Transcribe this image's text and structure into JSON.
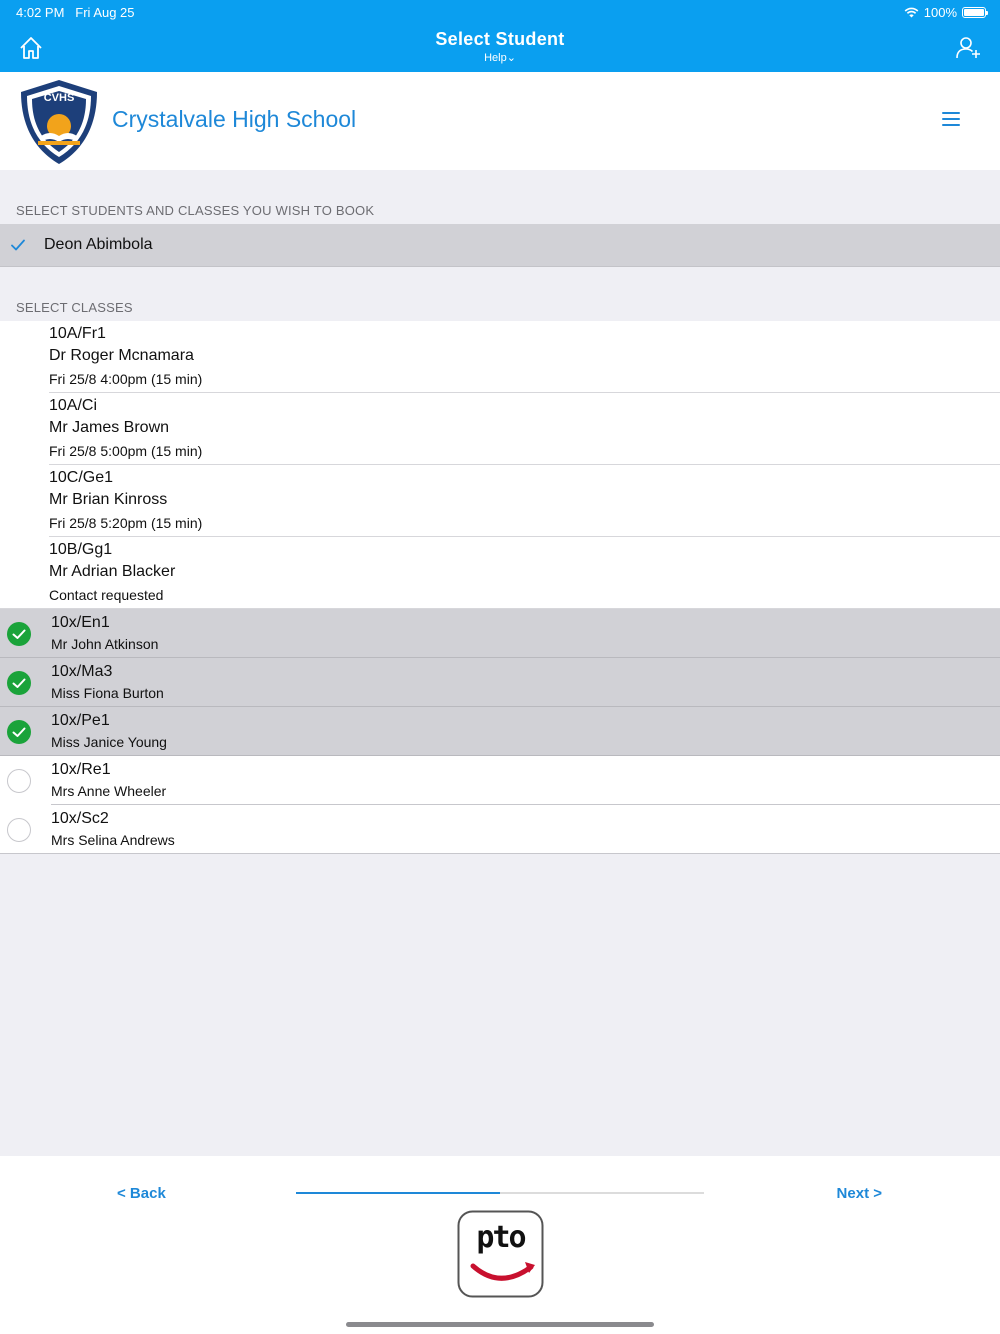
{
  "status_bar": {
    "time": "4:02 PM",
    "date": "Fri Aug 25",
    "battery": "100%"
  },
  "nav": {
    "title": "Select Student",
    "help": "Help⌄"
  },
  "school": {
    "logo_text": "CVHS",
    "name": "Crystalvale High School"
  },
  "students_section": {
    "label": "SELECT STUDENTS AND CLASSES YOU WISH TO BOOK",
    "student": {
      "name": "Deon Abimbola",
      "checked": true
    }
  },
  "classes_section": {
    "label": "SELECT CLASSES",
    "booked": [
      {
        "code": "10A/Fr1",
        "teacher": "Dr Roger Mcnamara",
        "detail": "Fri 25/8 4:00pm (15 min)"
      },
      {
        "code": "10A/Ci",
        "teacher": "Mr James Brown",
        "detail": "Fri 25/8 5:00pm (15 min)"
      },
      {
        "code": "10C/Ge1",
        "teacher": "Mr Brian Kinross",
        "detail": "Fri 25/8 5:20pm (15 min)"
      },
      {
        "code": "10B/Gg1",
        "teacher": "Mr Adrian Blacker",
        "detail": "Contact requested"
      }
    ],
    "selectable": [
      {
        "code": "10x/En1",
        "teacher": "Mr John Atkinson",
        "selected": true
      },
      {
        "code": "10x/Ma3",
        "teacher": "Miss Fiona Burton",
        "selected": true
      },
      {
        "code": "10x/Pe1",
        "teacher": "Miss Janice Young",
        "selected": true
      },
      {
        "code": "10x/Re1",
        "teacher": "Mrs Anne Wheeler",
        "selected": false
      },
      {
        "code": "10x/Sc2",
        "teacher": "Mrs Selina Andrews",
        "selected": false
      }
    ]
  },
  "footer": {
    "back_label": "< Back",
    "next_label": "Next >",
    "progress_fraction": 0.5,
    "logo_text": "pto"
  },
  "colors": {
    "nav": "#0a9ff0",
    "accent": "#1e88d8",
    "check_green": "#1aa33a"
  },
  "icons": [
    "home-icon",
    "add-user-icon",
    "wifi-icon",
    "battery-icon",
    "menu-icon",
    "checkmark-icon",
    "radio-checked-icon",
    "radio-unchecked-icon"
  ]
}
